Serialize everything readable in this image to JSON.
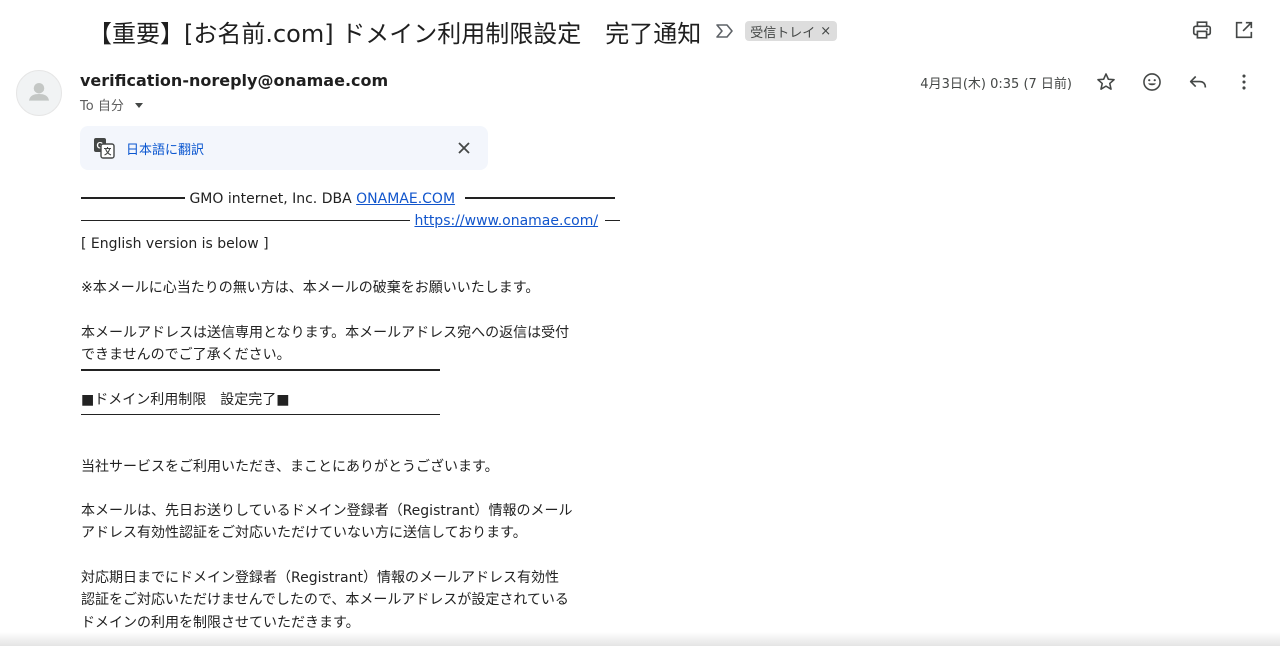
{
  "header": {
    "subject": "【重要】[お名前.com] ドメイン利用制限設定　完了通知",
    "label": "受信トレイ",
    "label_remove": "×"
  },
  "message": {
    "sender": "verification-noreply@onamae.com",
    "to_label": "To 自分",
    "date": "4月3日(木) 0:35 (7 日前)"
  },
  "translate": {
    "link_label": "日本語に翻訳"
  },
  "body": {
    "header_company": "GMO internet, Inc. DBA ",
    "header_link": "ONAMAE.COM",
    "url_link": "https://www.onamae.com/",
    "english_note": "[ English version is below ]",
    "notice1": "※本メールに心当たりの無い方は、本メールの破棄をお願いいたします。",
    "notice2_line1": "本メールアドレスは送信専用となります。本メールアドレス宛への返信は受付",
    "notice2_line2": "できませんのでご了承ください。",
    "section_title": "■ドメイン利用制限　設定完了■",
    "thanks": "当社サービスをご利用いただき、まことにありがとうございます。",
    "para1_line1": "本メールは、先日お送りしているドメイン登録者（Registrant）情報のメール",
    "para1_line2": "アドレス有効性認証をご対応いただけていない方に送信しております。",
    "para2_line1": "対応期日までにドメイン登録者（Registrant）情報のメールアドレス有効性",
    "para2_line2": "認証をご対応いただけませんでしたので、本メールアドレスが設定されている",
    "para2_line3": "ドメインの利用を制限させていただきます。"
  },
  "icons": {
    "print": "printer-icon",
    "open_new": "open-in-new-window-icon",
    "star": "star-icon",
    "emoji": "emoji-reaction-icon",
    "reply": "reply-icon",
    "more": "more-vertical-icon",
    "translate": "google-translate-icon",
    "close": "close-icon",
    "important": "important-marker-icon",
    "avatar": "default-avatar-icon"
  },
  "colors": {
    "link": "#1155cc",
    "translate_link": "#0b57d0",
    "translate_bg": "#f3f6fc",
    "chip_bg": "#dddddd"
  }
}
